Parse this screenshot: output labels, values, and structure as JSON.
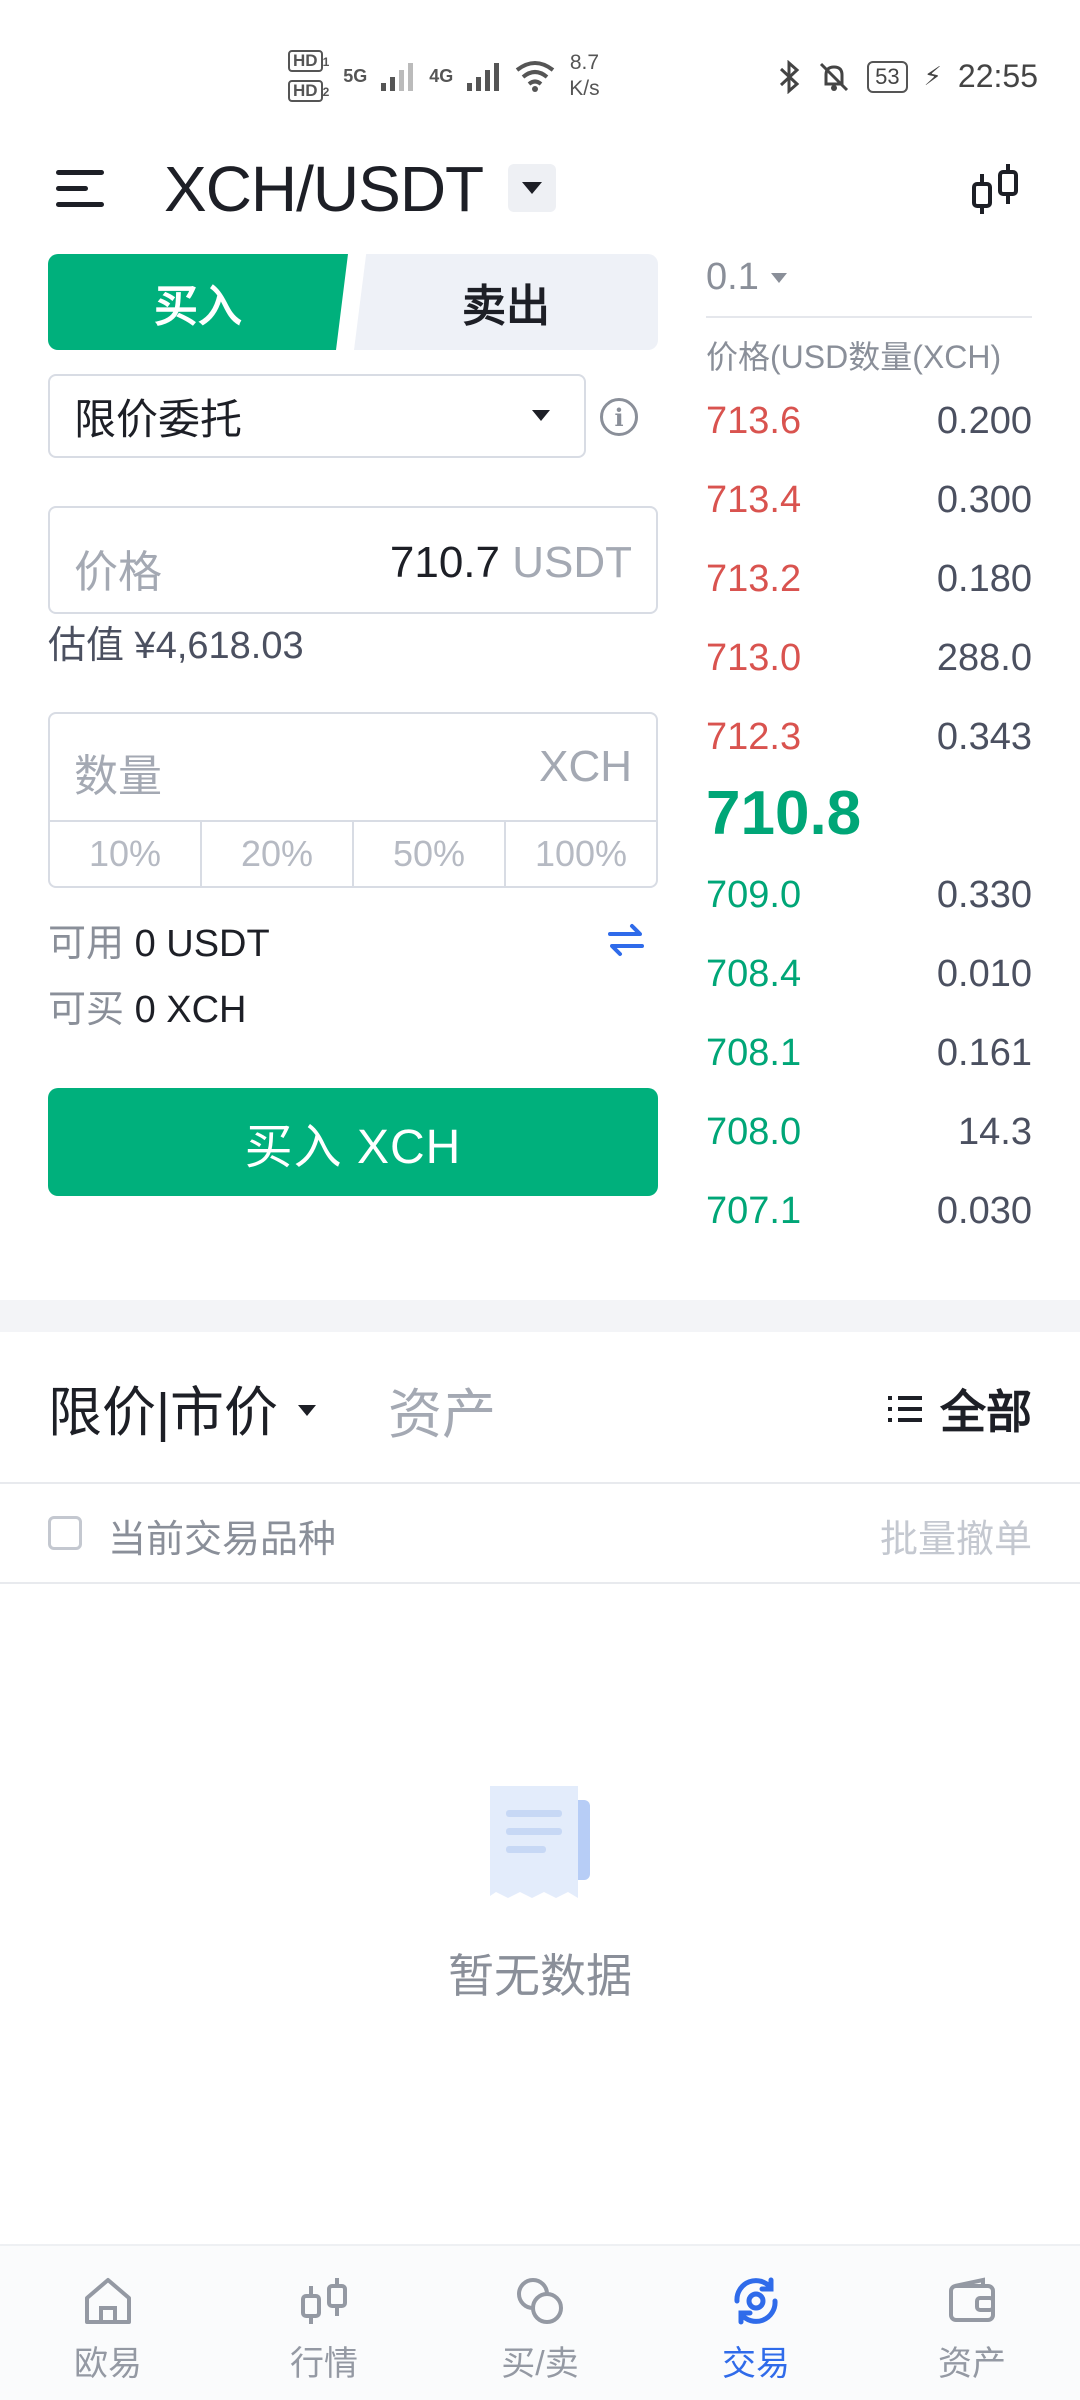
{
  "status_bar": {
    "hd1": "HD",
    "hd1_sub": "1",
    "hd2": "HD",
    "hd2_sub": "2",
    "net1": "5G",
    "net2": "4G",
    "speed_value": "8.7",
    "speed_unit": "K/s",
    "battery": "53",
    "time": "22:55"
  },
  "header": {
    "pair": "XCH/USDT"
  },
  "trade_form": {
    "buy_tab": "买入",
    "sell_tab": "卖出",
    "order_type": "限价委托",
    "price_label": "价格",
    "price_value": "710.7",
    "price_unit": "USDT",
    "estimate": "估值 ¥4,618.03",
    "qty_label": "数量",
    "qty_unit": "XCH",
    "percents": [
      "10%",
      "20%",
      "50%",
      "100%"
    ],
    "available_label": "可用",
    "available_value": "0 USDT",
    "can_buy_label": "可买",
    "can_buy_value": "0 XCH",
    "submit": "买入 XCH"
  },
  "order_book": {
    "depth": "0.1",
    "header": "价格(USD数量(XCH)",
    "asks": [
      {
        "price": "713.6",
        "qty": "0.200"
      },
      {
        "price": "713.4",
        "qty": "0.300"
      },
      {
        "price": "713.2",
        "qty": "0.180"
      },
      {
        "price": "713.0",
        "qty": "288.0"
      },
      {
        "price": "712.3",
        "qty": "0.343"
      }
    ],
    "last_price": "710.8",
    "bids": [
      {
        "price": "709.0",
        "qty": "0.330"
      },
      {
        "price": "708.4",
        "qty": "0.010"
      },
      {
        "price": "708.1",
        "qty": "0.161"
      },
      {
        "price": "708.0",
        "qty": "14.3"
      },
      {
        "price": "707.1",
        "qty": "0.030"
      }
    ]
  },
  "orders": {
    "tab_orders": "限价|市价",
    "tab_assets": "资产",
    "all": "全部",
    "current_pair": "当前交易品种",
    "batch_cancel": "批量撤单",
    "empty": "暂无数据"
  },
  "bottom_nav": [
    {
      "label": "欧易",
      "icon": "home-icon"
    },
    {
      "label": "行情",
      "icon": "candlestick-icon"
    },
    {
      "label": "买/卖",
      "icon": "coins-icon"
    },
    {
      "label": "交易",
      "icon": "trade-icon"
    },
    {
      "label": "资产",
      "icon": "wallet-icon"
    }
  ],
  "colors": {
    "buy_green": "#00b07c",
    "ask_red": "#d9534f",
    "bid_green": "#00a677",
    "active_blue": "#2f6bea"
  }
}
